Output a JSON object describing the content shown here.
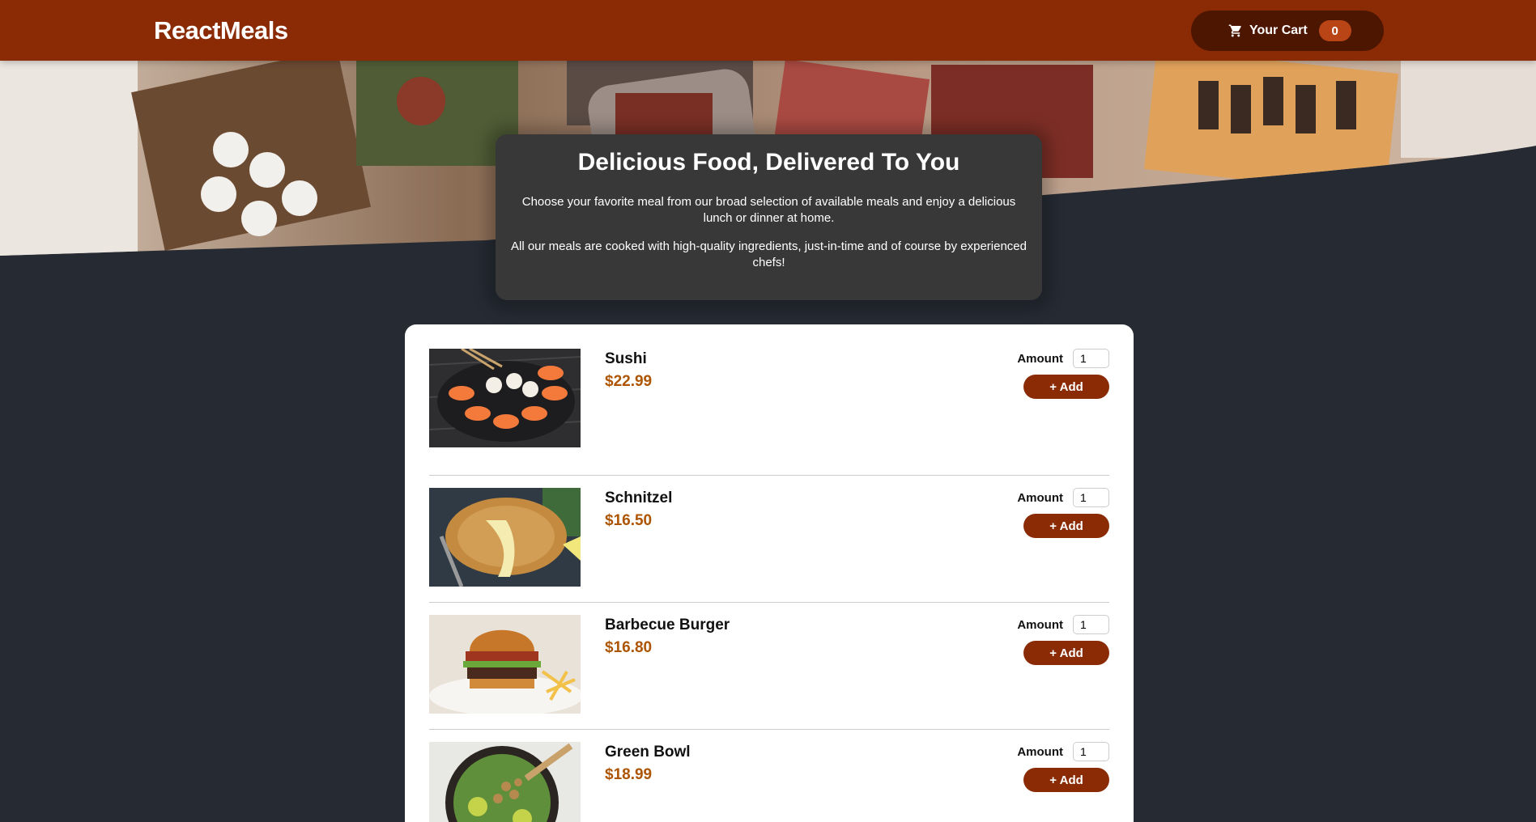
{
  "header": {
    "logo": "ReactMeals",
    "cart_label": "Your Cart",
    "cart_count": "0",
    "cart_icon": "cart-icon"
  },
  "summary": {
    "title": "Delicious Food, Delivered To You",
    "paragraph1": "Choose your favorite meal from our broad selection of available meals and enjoy a delicious lunch or dinner at home.",
    "paragraph2": "All our meals are cooked with high-quality ingredients, just-in-time and of course by experienced chefs!"
  },
  "meals": [
    {
      "name": "Sushi",
      "price": "$22.99",
      "amount_label": "Amount",
      "amount_value": "1",
      "add_label": "+ Add"
    },
    {
      "name": "Schnitzel",
      "price": "$16.50",
      "amount_label": "Amount",
      "amount_value": "1",
      "add_label": "+ Add"
    },
    {
      "name": "Barbecue Burger",
      "price": "$16.80",
      "amount_label": "Amount",
      "amount_value": "1",
      "add_label": "+ Add"
    },
    {
      "name": "Green Bowl",
      "price": "$18.99",
      "amount_label": "Amount",
      "amount_value": "1",
      "add_label": "+ Add"
    }
  ],
  "colors": {
    "header": "#8a2b06",
    "cart_button": "#4d1601",
    "badge": "#b94517",
    "background": "#252a33",
    "summary": "#383838",
    "price": "#ad5502"
  }
}
